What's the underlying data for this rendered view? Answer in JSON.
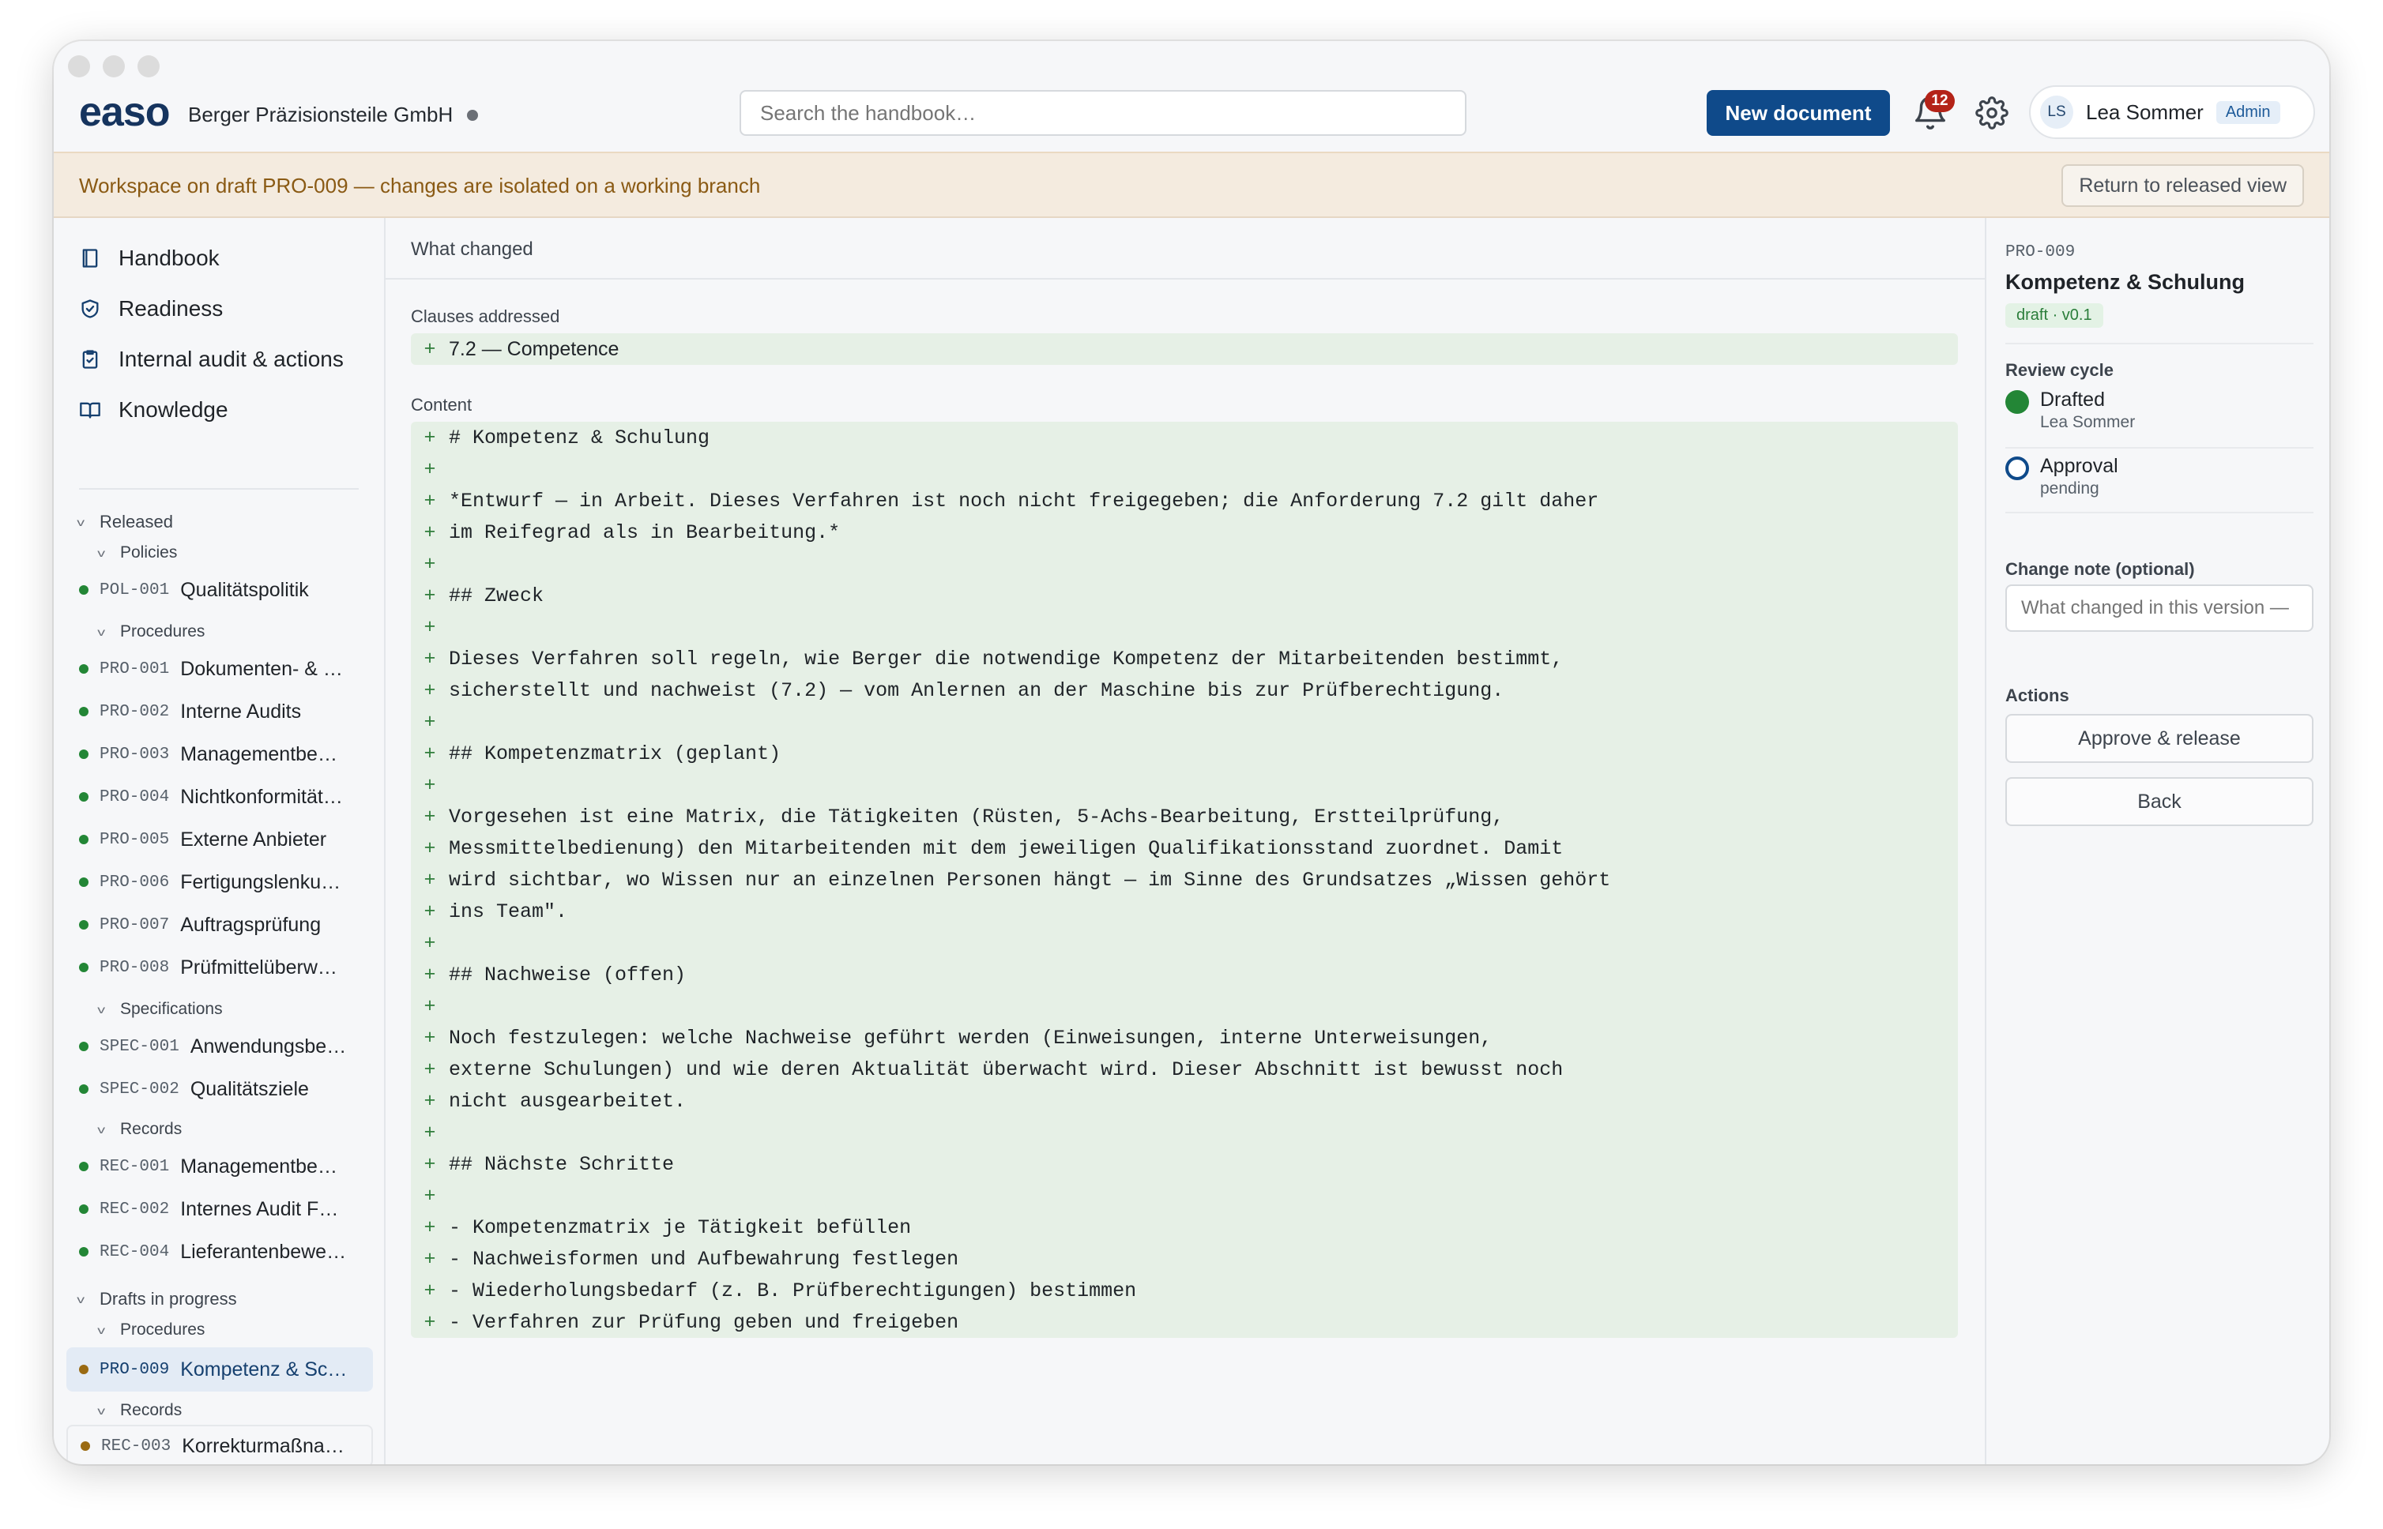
{
  "app": {
    "logo": "easo",
    "org_name": "Berger Präzisionsteile GmbH"
  },
  "header": {
    "search_placeholder": "Search the handbook…",
    "new_document_label": "New document",
    "notification_count": "12",
    "user_initials": "LS",
    "user_name": "Lea Sommer",
    "user_role": "Admin"
  },
  "banner": {
    "text": "Workspace on draft PRO-009 — changes are isolated on a working branch",
    "return_label": "Return to released view"
  },
  "sidebar": {
    "nav": [
      {
        "label": "Handbook",
        "icon": "book-icon"
      },
      {
        "label": "Readiness",
        "icon": "shield-check-icon"
      },
      {
        "label": "Internal audit & actions",
        "icon": "clipboard-icon"
      },
      {
        "label": "Knowledge",
        "icon": "open-book-icon"
      }
    ],
    "released_label": "Released",
    "policies_label": "Policies",
    "procedures_label": "Procedures",
    "specifications_label": "Specifications",
    "records_label": "Records",
    "drafts_label": "Drafts in progress",
    "drafts_procedures_label": "Procedures",
    "drafts_records_label": "Records",
    "policies": [
      {
        "id": "POL-001",
        "title": "Qualitätspolitik"
      }
    ],
    "procedures": [
      {
        "id": "PRO-001",
        "title": "Dokumenten- & …"
      },
      {
        "id": "PRO-002",
        "title": "Interne Audits"
      },
      {
        "id": "PRO-003",
        "title": "Managementbe…"
      },
      {
        "id": "PRO-004",
        "title": "Nichtkonformität…"
      },
      {
        "id": "PRO-005",
        "title": "Externe Anbieter"
      },
      {
        "id": "PRO-006",
        "title": "Fertigungslenku…"
      },
      {
        "id": "PRO-007",
        "title": "Auftragsprüfung"
      },
      {
        "id": "PRO-008",
        "title": "Prüfmittelüberw…"
      }
    ],
    "specifications": [
      {
        "id": "SPEC-001",
        "title": "Anwendungsbe…"
      },
      {
        "id": "SPEC-002",
        "title": "Qualitätsziele"
      }
    ],
    "records": [
      {
        "id": "REC-001",
        "title": "Managementbe…"
      },
      {
        "id": "REC-002",
        "title": "Internes Audit F…"
      },
      {
        "id": "REC-004",
        "title": "Lieferantenbewe…"
      }
    ],
    "draft_procedures": [
      {
        "id": "PRO-009",
        "title": "Kompetenz & Sc…"
      }
    ],
    "draft_records": [
      {
        "id": "REC-003",
        "title": "Korrekturmaßna…"
      }
    ]
  },
  "main": {
    "header": "What changed",
    "clauses_label": "Clauses addressed",
    "clause_line": "7.2 — Competence",
    "content_label": "Content",
    "diff_marker": "+",
    "lines": [
      "# Kompetenz & Schulung",
      "",
      "*Entwurf — in Arbeit. Dieses Verfahren ist noch nicht freigegeben; die Anforderung 7.2 gilt daher",
      "im Reifegrad als in Bearbeitung.*",
      "",
      "## Zweck",
      "",
      "Dieses Verfahren soll regeln, wie Berger die notwendige Kompetenz der Mitarbeitenden bestimmt,",
      "sicherstellt und nachweist (7.2) — vom Anlernen an der Maschine bis zur Prüfberechtigung.",
      "",
      "## Kompetenzmatrix (geplant)",
      "",
      "Vorgesehen ist eine Matrix, die Tätigkeiten (Rüsten, 5-Achs-Bearbeitung, Erstteilprüfung,",
      "Messmittelbedienung) den Mitarbeitenden mit dem jeweiligen Qualifikationsstand zuordnet. Damit",
      "wird sichtbar, wo Wissen nur an einzelnen Personen hängt — im Sinne des Grundsatzes „Wissen gehört",
      "ins Team\".",
      "",
      "## Nachweise (offen)",
      "",
      "Noch festzulegen: welche Nachweise geführt werden (Einweisungen, interne Unterweisungen,",
      "externe Schulungen) und wie deren Aktualität überwacht wird. Dieser Abschnitt ist bewusst noch",
      "nicht ausgearbeitet.",
      "",
      "## Nächste Schritte",
      "",
      "- Kompetenzmatrix je Tätigkeit befüllen",
      "- Nachweisformen und Aufbewahrung festlegen",
      "- Wiederholungsbedarf (z. B. Prüfberechtigungen) bestimmen",
      "- Verfahren zur Prüfung geben und freigeben"
    ]
  },
  "panel": {
    "doc_id": "PRO-009",
    "doc_title": "Kompetenz & Schulung",
    "status_badge": "draft · v0.1",
    "review_label": "Review cycle",
    "steps": [
      {
        "name": "Drafted",
        "sub": "Lea Sommer",
        "state": "done"
      },
      {
        "name": "Approval",
        "sub": "pending",
        "state": "open"
      }
    ],
    "change_note_label": "Change note (optional)",
    "change_note_placeholder": "What changed in this version —",
    "actions_label": "Actions",
    "approve_label": "Approve & release",
    "back_label": "Back"
  },
  "colors": {
    "accent": "#0f4a8a",
    "released_dot": "#238636",
    "draft_dot": "#9a6a12",
    "diff_bg": "#e6f0e6",
    "banner_bg": "#f4ebdf"
  }
}
